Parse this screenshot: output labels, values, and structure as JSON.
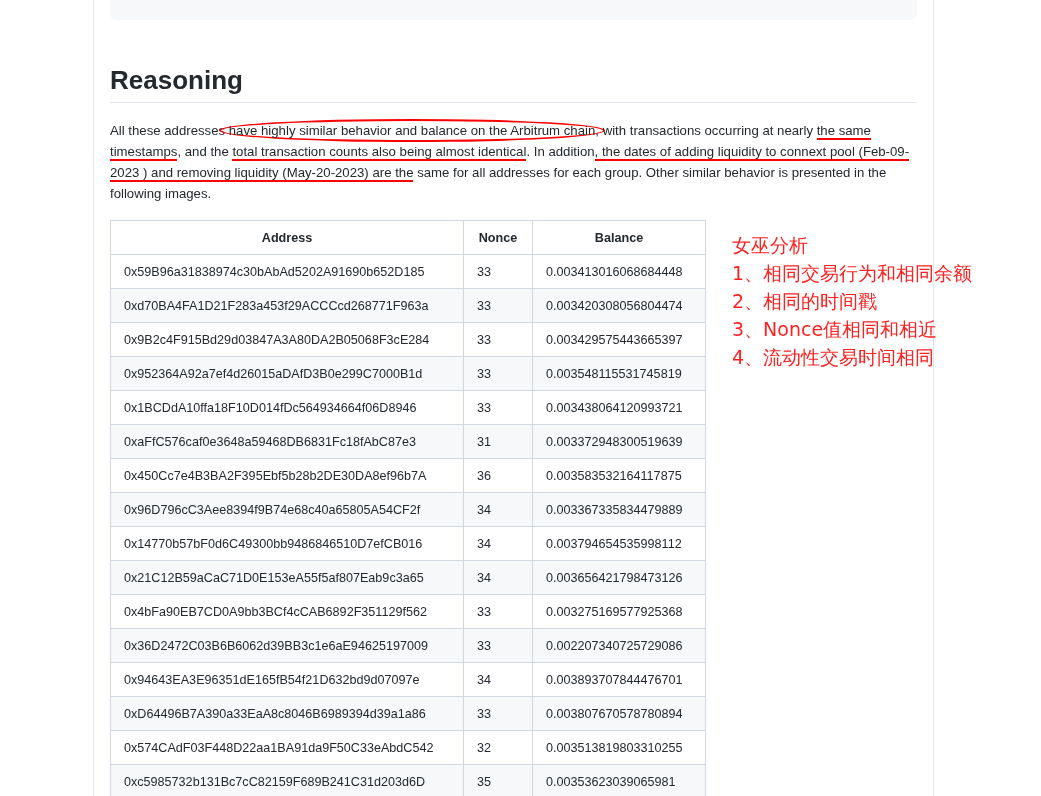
{
  "heading": "Reasoning",
  "paragraph": [
    {
      "text": "All these addresses ",
      "underlined": false,
      "circled": false
    },
    {
      "text": "have highly similar behavior and balance on the Arbitrum chain",
      "underlined": false,
      "circled": true
    },
    {
      "text": ", with transactions occurring at nearly ",
      "underlined": false,
      "circled": false
    },
    {
      "text": "the same timestamps",
      "underlined": true,
      "circled": false
    },
    {
      "text": ", and the ",
      "underlined": false,
      "circled": false
    },
    {
      "text": "total transaction counts also being almost identical",
      "underlined": true,
      "circled": false
    },
    {
      "text": ". In addition",
      "underlined": false,
      "circled": false
    },
    {
      "text": ", the dates of adding liquidity to connext pool (Feb-09-2023 ) and removing liquidity (May-20-2023) are the",
      "underlined": true,
      "circled": false
    },
    {
      "text": " same for all addresses for each group. Other similar behavior is presented in the following images.",
      "underlined": false,
      "circled": false
    }
  ],
  "table": {
    "columns": [
      "Address",
      "Nonce",
      "Balance"
    ],
    "rows": [
      [
        "0x59B96a31838974c30bAbAd5202A91690b652D185",
        "33",
        "0.003413016068684448"
      ],
      [
        "0xd70BA4FA1D21F283a453f29ACCCcd268771F963a",
        "33",
        "0.003420308056804474"
      ],
      [
        "0x9B2c4F915Bd29d03847A3A80DA2B05068F3cE284",
        "33",
        "0.003429575443665397"
      ],
      [
        "0x952364A92a7ef4d26015aDAfD3B0e299C7000B1d",
        "33",
        "0.003548115531745819"
      ],
      [
        "0x1BCDdA10ffa18F10D014fDc564934664f06D8946",
        "33",
        "0.003438064120993721"
      ],
      [
        "0xaFfC576caf0e3648a59468DB6831Fc18fAbC87e3",
        "31",
        "0.003372948300519639"
      ],
      [
        "0x450Cc7e4B3BA2F395Ebf5b28b2DE30DA8ef96b7A",
        "36",
        "0.003583532164117875"
      ],
      [
        "0x96D796cC3Aee8394f9B74e68c40a65805A54CF2f",
        "34",
        "0.003367335834479889"
      ],
      [
        "0x14770b57bF0d6C49300bb9486846510D7efCB016",
        "34",
        "0.003794654535998112"
      ],
      [
        "0x21C12B59aCaC71D0E153eA55f5af807Eab9c3a65",
        "34",
        "0.003656421798473126"
      ],
      [
        "0x4bFa90EB7CD0A9bb3BCf4cCAB6892F351129f562",
        "33",
        "0.003275169577925368"
      ],
      [
        "0x36D2472C03B6B6062d39BB3c1e6aE94625197009",
        "33",
        "0.002207340725729086"
      ],
      [
        "0x94643EA3E96351dE165fB54f21D632bd9d07097e",
        "34",
        "0.003893707844476701"
      ],
      [
        "0xD64496B7A390a33EaA8c8046B6989394d39a1a86",
        "33",
        "0.003807670578780894"
      ],
      [
        "0x574CAdF03F448D22aa1BA91da9F50C33eAbdC542",
        "32",
        "0.003513819803310255"
      ],
      [
        "0xc5985732b131Bc7cC82159F689B241C31d203d6D",
        "35",
        "0.00353623039065981"
      ]
    ]
  },
  "notes": [
    "女巫分析",
    "1、相同交易行为和相同余额",
    "2、相同的时间戳",
    "3、Nonce值相同和相近",
    "4、流动性交易时间相同"
  ]
}
